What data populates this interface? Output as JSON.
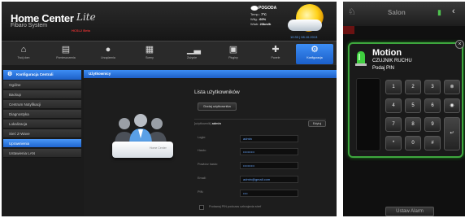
{
  "left": {
    "logo": {
      "title": "Home Center",
      "lite": "Lite",
      "subtitle": "Fibaro System",
      "beta": "HCSL2 Beta"
    },
    "weather": {
      "title": "POGODA",
      "temp": {
        "label": "Temp.:",
        "value": "7ºC"
      },
      "humidity": {
        "label": "Wilg.:",
        "value": "60%"
      },
      "wind": {
        "label": "Wiatr:",
        "value": "23km/h"
      },
      "date": "10:33 | 08.10.2013",
      "icon": "sun-cloud-icon"
    },
    "nav": [
      {
        "label": "Twój dom",
        "icon": "house-icon"
      },
      {
        "label": "Pomieszczenia",
        "icon": "rooms-icon"
      },
      {
        "label": "Urządzenia",
        "icon": "bulb-icon"
      },
      {
        "label": "Sceny",
        "icon": "scene-icon"
      },
      {
        "label": "Zużycie",
        "icon": "chart-icon"
      },
      {
        "label": "Pluginy",
        "icon": "plugin-icon"
      },
      {
        "label": "Panele",
        "icon": "panel-icon"
      },
      {
        "label": "Konfiguracja",
        "icon": "gear-icon",
        "active": true
      }
    ],
    "sidebar": {
      "header": "Konfiguracja Centrali",
      "items": [
        {
          "label": "Ogólne"
        },
        {
          "label": "Backup"
        },
        {
          "label": "Centrum Notyfikacji"
        },
        {
          "label": "Diagnostyka"
        },
        {
          "label": "Lokalizacja"
        },
        {
          "label": "Sieć Z-Wave"
        },
        {
          "label": "Uprawnienia",
          "active": true
        },
        {
          "label": "Ustawienia LAN"
        }
      ]
    },
    "content": {
      "tab": "Użytkownicy",
      "panel_title": "Lista użytkowników",
      "add_user": "Dodaj użytkownika",
      "user_header_prefix": "[użytkownik]",
      "user_header_name": "admin",
      "edit": "Edytuj",
      "server_logo": "Home Center",
      "fields": [
        {
          "label": "Login:",
          "value": "admin"
        },
        {
          "label": "Hasło:",
          "value": "••••••••••"
        },
        {
          "label": "Powtórz hasło:",
          "value": "••••••••••"
        },
        {
          "label": "Email:",
          "value": "admin@gmail.com"
        },
        {
          "label": "PIN:",
          "value": "••••"
        }
      ],
      "pin_text": "Podawaj PIN podczas uzbrajania stref"
    }
  },
  "right": {
    "room": "Salon",
    "modal": {
      "title": "Motion",
      "subtitle": "CZUJNIK RUCHU",
      "pin_label": "Podaj PIN",
      "close": "×",
      "keys": [
        "1",
        "2",
        "3",
        "⊗",
        "4",
        "5",
        "6",
        "◉",
        "7",
        "8",
        "9",
        "*",
        "0",
        "#",
        "↵"
      ]
    },
    "bottom_button": "Ustaw Alarm"
  },
  "colors": {
    "accent": "#2f7ae5",
    "keypad_border": "#3ea73e"
  }
}
